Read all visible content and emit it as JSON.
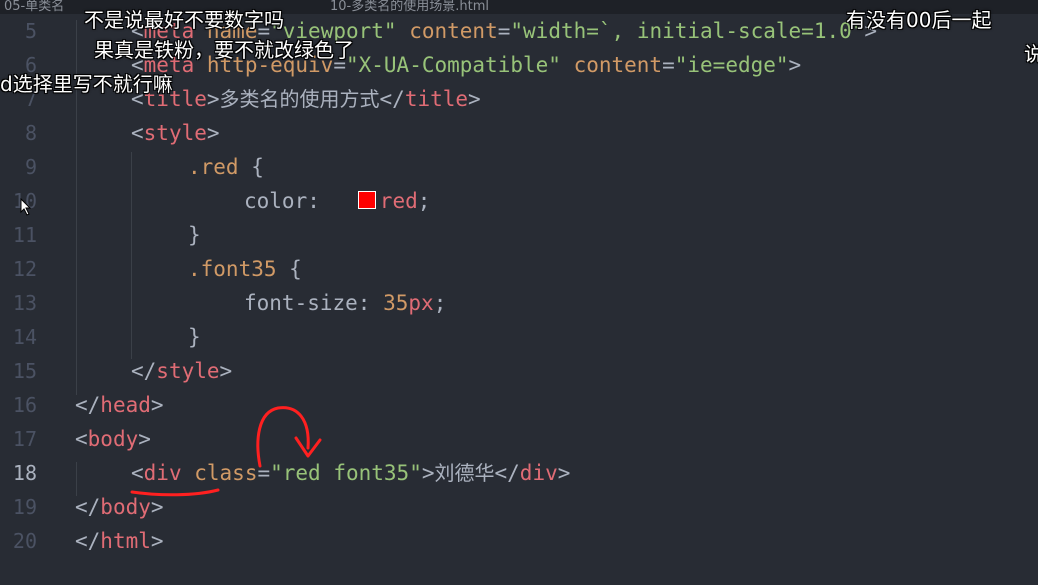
{
  "tab": {
    "left_text": "05-单类名",
    "right_text": "10-多类名的使用场景.html"
  },
  "line_numbers": [
    "5",
    "6",
    "7",
    "8",
    "9",
    "10",
    "11",
    "12",
    "13",
    "14",
    "15",
    "16",
    "17",
    "18",
    "19",
    "20"
  ],
  "active_line": "18",
  "code": {
    "l5": {
      "open": "<",
      "tag": "meta",
      "a1": "name",
      "eq1": "=",
      "v1": "\"viewport\"",
      "a2": "content",
      "eq2": "=",
      "v2": "\"width=`, initial-scale=1.0\"",
      "close": ">"
    },
    "l6": {
      "open": "<",
      "tag": "meta",
      "a1": "http-equiv",
      "eq1": "=",
      "v1": "\"X-UA-Compatible\"",
      "a2": "content",
      "eq2": "=",
      "v2": "\"ie=edge\"",
      "close": ">"
    },
    "l7": {
      "open": "<",
      "tag": "title",
      "close": ">",
      "text": "多类名的使用方式",
      "eopen": "</",
      "etag": "title",
      "eclose": ">"
    },
    "l8": {
      "open": "<",
      "tag": "style",
      "close": ">"
    },
    "l9": {
      "selector": ".red",
      "brace": " {"
    },
    "l10": {
      "prop": "color:",
      "value": "red",
      "semi": ";"
    },
    "l11": {
      "brace": "}"
    },
    "l12": {
      "selector": ".font35",
      "brace": " {"
    },
    "l13": {
      "prop": "font-size:",
      "num": "35",
      "unit": "px",
      "semi": ";"
    },
    "l14": {
      "brace": "}"
    },
    "l15": {
      "open": "</",
      "tag": "style",
      "close": ">"
    },
    "l16": {
      "open": "</",
      "tag": "head",
      "close": ">"
    },
    "l17": {
      "open": "<",
      "tag": "body",
      "close": ">"
    },
    "l18": {
      "open": "<",
      "tag": "div",
      "a1": "class",
      "eq1": "=",
      "v1": "\"red font35\"",
      "close": ">",
      "text": "刘德华",
      "eopen": "</",
      "etag": "div",
      "eclose": ">"
    },
    "l19": {
      "open": "</",
      "tag": "body",
      "close": ">"
    },
    "l20": {
      "open": "</",
      "tag": "html",
      "close": ">"
    }
  },
  "danmaku": {
    "d1": "不是说最好不要数字吗",
    "d2": "果真是铁粉，要不就改绿色了",
    "d3": "d选择里写不就行嘛",
    "d4": "有没有00后一起",
    "d5": "说"
  },
  "colors": {
    "background": "#282c34",
    "tag": "#e06c75",
    "string": "#98c379",
    "number": "#d19a66",
    "annotation": "#ff2020"
  }
}
